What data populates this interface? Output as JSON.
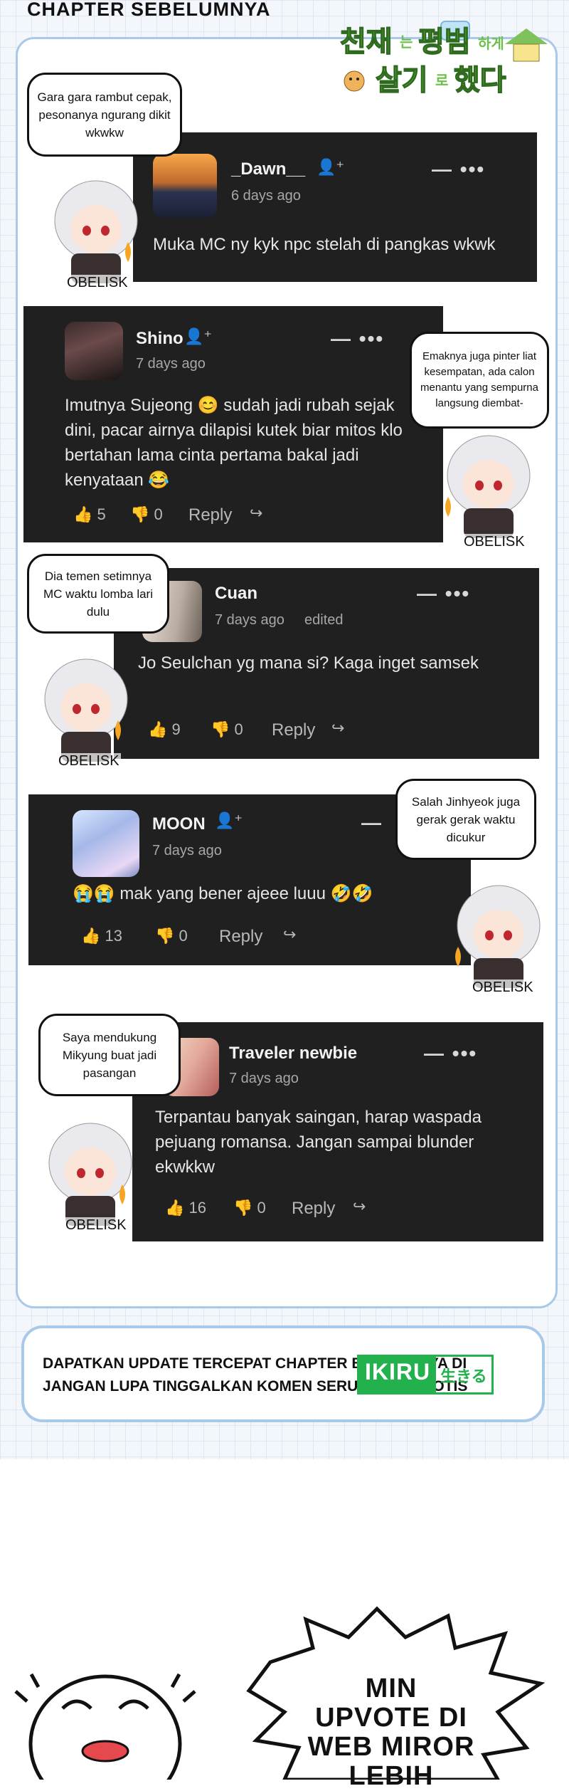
{
  "heading": "CHAPTER SEBELUMNYA",
  "logo_text": {
    "line1a": "천재는",
    "line1b": "평범",
    "line1c": "하게",
    "line2a": "살기",
    "line2b": "로",
    "line2c": "했다"
  },
  "mascot_label": "OBELISK",
  "comments": [
    {
      "user": "_Dawn__",
      "time": "6 days ago",
      "text": "Muka MC ny kyk npc stelah di pangkas wkwk",
      "menu": "— •••",
      "bubble": "Gara gara rambut cepak, pesonanya ngurang dikit wkwkw"
    },
    {
      "user": "Shino",
      "time": "7 days ago",
      "text": "Imutnya Sujeong 😊 sudah jadi rubah sejak dini, pacar airnya dilapisi kutek biar mitos klo bertahan lama cinta pertama bakal jadi kenyataan 😂",
      "menu": "— •••",
      "likes": "5",
      "dislikes": "0",
      "reply": "Reply",
      "bubble": "Emaknya juga pinter liat kesempatan, ada calon menantu yang sempurna langsung diembat-"
    },
    {
      "user": "Cuan",
      "time": "7 days ago",
      "edited": "edited",
      "text": "Jo Seulchan yg mana si? Kaga inget samsek",
      "menu": "— •••",
      "likes": "9",
      "dislikes": "0",
      "reply": "Reply",
      "bubble": "Dia temen setimnya MC waktu lomba lari dulu"
    },
    {
      "user": "MOON",
      "time": "7 days ago",
      "text": "😭😭 mak yang bener ajeee luuu 🤣🤣",
      "menu": "—",
      "likes": "13",
      "dislikes": "0",
      "reply": "Reply",
      "bubble": "Salah Jinhyeok juga gerak gerak waktu dicukur"
    },
    {
      "user": "Traveler newbie",
      "time": "7 days ago",
      "text": "Terpantau banyak saingan, harap waspada pejuang romansa. Jangan sampai blunder ekwkkw",
      "menu": "— •••",
      "likes": "16",
      "dislikes": "0",
      "reply": "Reply",
      "bubble": "Saya mendukung Mikyung buat jadi pasangan"
    }
  ],
  "banner": {
    "line1": "DAPATKAN UPDATE TERCEPAT CHAPTER BERIKUTNYA DI",
    "line2": "JANGAN LUPA TINGGALKAN KOMEN SERU BIAR DI NOTIS",
    "brand": "IKIRU",
    "brand_jp": "生きる",
    "brand_color": "#22b14c"
  },
  "shout": {
    "line1": "MIN",
    "line2": "UPVOTE DI",
    "line3": "WEB MIROR",
    "line4": "LEBIH"
  }
}
